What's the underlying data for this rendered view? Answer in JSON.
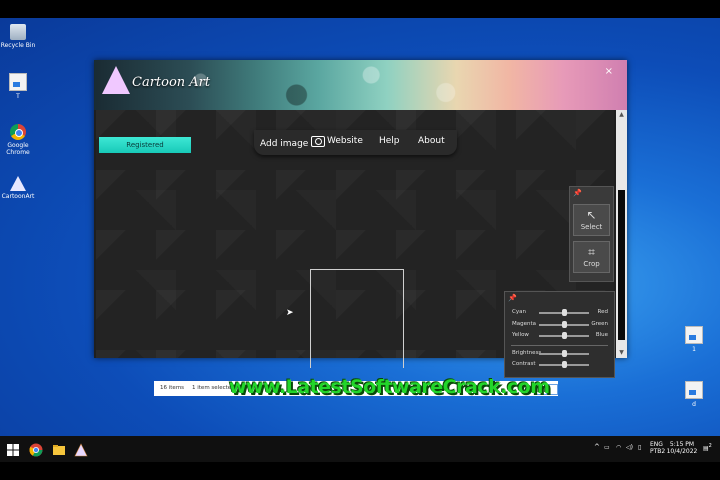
{
  "desktop": {
    "icons": [
      {
        "label": "Recycle Bin"
      },
      {
        "label": "T"
      },
      {
        "label": "Google Chrome"
      },
      {
        "label": "CartoonArt"
      },
      {
        "label": "1"
      },
      {
        "label": "d"
      }
    ]
  },
  "app": {
    "logo_text": "Cartoon Art",
    "close_glyph": "×",
    "registered_label": "Registered",
    "menu": {
      "add_image": "Add image",
      "website": "Website",
      "help": "Help",
      "about": "About"
    },
    "tools": {
      "select": "Select",
      "crop": "Crop"
    },
    "color": {
      "rows": [
        {
          "left": "Cyan",
          "right": "Red",
          "value": 0.5
        },
        {
          "left": "Magenta",
          "right": "Green",
          "value": 0.5
        },
        {
          "left": "Yellow",
          "right": "Blue",
          "value": 0.5
        }
      ],
      "adjust": [
        {
          "label": "Brightness",
          "value": 0.5
        },
        {
          "label": "Contrast",
          "value": 0.5
        }
      ]
    }
  },
  "explorer": {
    "item_count": "16 items",
    "selection": "1 item selected"
  },
  "watermark": "www.LatestSoftwareCrack.com",
  "taskbar": {
    "lang_top": "ENG",
    "lang_bottom": "PTB2",
    "time": "5:15 PM",
    "date": "10/4/2022",
    "notif_count": "2"
  },
  "colors": {
    "accent_registered": "#18c9b8",
    "watermark": "#22d62a",
    "desktop_blue": "#1a6fd6"
  }
}
